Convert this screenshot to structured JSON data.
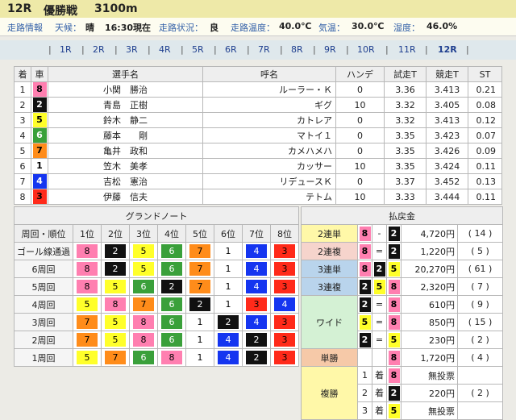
{
  "header": {
    "race": "12R",
    "name": "優勝戦",
    "distance": "3100m"
  },
  "conditions": {
    "road_info_label": "走路情報",
    "weather_label": "天候：",
    "weather": "晴",
    "time": "16:30現在",
    "track_label": "走路状況：",
    "track": "良",
    "road_temp_label": "走路温度：",
    "road_temp": "40.0℃",
    "air_temp_label": "気温：",
    "air_temp": "30.0℃",
    "humidity_label": "湿度：",
    "humidity": "46.0%"
  },
  "tabs": [
    {
      "label": "1R",
      "current": false
    },
    {
      "label": "2R",
      "current": false
    },
    {
      "label": "3R",
      "current": false
    },
    {
      "label": "4R",
      "current": false
    },
    {
      "label": "5R",
      "current": false
    },
    {
      "label": "6R",
      "current": false
    },
    {
      "label": "7R",
      "current": false
    },
    {
      "label": "8R",
      "current": false
    },
    {
      "label": "9R",
      "current": false
    },
    {
      "label": "10R",
      "current": false
    },
    {
      "label": "11R",
      "current": false
    },
    {
      "label": "12R",
      "current": true
    }
  ],
  "colors": {
    "1": "#ffffff",
    "2": "#111111",
    "3": "#ff2a1a",
    "4": "#1535f0",
    "5": "#ffff2a",
    "6": "#3aa03a",
    "7": "#ff8c1a",
    "8": "#ff7fb0"
  },
  "text_colors": {
    "1": "#000",
    "2": "#fff",
    "3": "#000",
    "4": "#fff",
    "5": "#000",
    "6": "#fff",
    "7": "#000",
    "8": "#000"
  },
  "entries": {
    "headers": [
      "着",
      "車",
      "選手名",
      "呼名",
      "ハンデ",
      "試走T",
      "競走T",
      "ST"
    ],
    "rows": [
      {
        "pos": "1",
        "car": "8",
        "rider": "小関　勝治",
        "bike": "ルーラー・Ｋ",
        "hande": "0",
        "trial": "3.36",
        "race": "3.413",
        "st": "0.21"
      },
      {
        "pos": "2",
        "car": "2",
        "rider": "青島　正樹",
        "bike": "ギグ",
        "hande": "10",
        "trial": "3.32",
        "race": "3.405",
        "st": "0.08"
      },
      {
        "pos": "3",
        "car": "5",
        "rider": "鈴木　静二",
        "bike": "カトレア",
        "hande": "0",
        "trial": "3.32",
        "race": "3.413",
        "st": "0.12"
      },
      {
        "pos": "4",
        "car": "6",
        "rider": "藤本　　剛",
        "bike": "マトイ１",
        "hande": "0",
        "trial": "3.35",
        "race": "3.423",
        "st": "0.07"
      },
      {
        "pos": "5",
        "car": "7",
        "rider": "亀井　政和",
        "bike": "カメハメハ",
        "hande": "0",
        "trial": "3.35",
        "race": "3.426",
        "st": "0.09"
      },
      {
        "pos": "6",
        "car": "1",
        "rider": "笠木　美孝",
        "bike": "カッサー",
        "hande": "10",
        "trial": "3.35",
        "race": "3.424",
        "st": "0.11"
      },
      {
        "pos": "7",
        "car": "4",
        "rider": "吉松　憲治",
        "bike": "リデュースＫ",
        "hande": "0",
        "trial": "3.37",
        "race": "3.452",
        "st": "0.13"
      },
      {
        "pos": "8",
        "car": "3",
        "rider": "伊藤　信夫",
        "bike": "テトム",
        "hande": "10",
        "trial": "3.33",
        "race": "3.444",
        "st": "0.11"
      }
    ]
  },
  "grand_note": {
    "title": "グランドノート",
    "corner_label": "周回・順位",
    "headers": [
      "1位",
      "2位",
      "3位",
      "4位",
      "5位",
      "6位",
      "7位",
      "8位"
    ],
    "rows": [
      {
        "label": "ゴール線通過",
        "cells": [
          "8",
          "2",
          "5",
          "6",
          "7",
          "1",
          "4",
          "3"
        ]
      },
      {
        "label": "6周回",
        "cells": [
          "8",
          "2",
          "5",
          "6",
          "7",
          "1",
          "4",
          "3"
        ]
      },
      {
        "label": "5周回",
        "cells": [
          "8",
          "5",
          "6",
          "2",
          "7",
          "1",
          "4",
          "3"
        ]
      },
      {
        "label": "4周回",
        "cells": [
          "5",
          "8",
          "7",
          "6",
          "2",
          "1",
          "3",
          "4"
        ]
      },
      {
        "label": "3周回",
        "cells": [
          "7",
          "5",
          "8",
          "6",
          "1",
          "2",
          "4",
          "3"
        ]
      },
      {
        "label": "2周回",
        "cells": [
          "7",
          "5",
          "8",
          "6",
          "1",
          "4",
          "2",
          "3"
        ]
      },
      {
        "label": "1周回",
        "cells": [
          "5",
          "7",
          "6",
          "8",
          "1",
          "4",
          "2",
          "3"
        ]
      }
    ]
  },
  "payout": {
    "title": "払戻金",
    "rows": [
      {
        "bet": "2連単",
        "bg": "#fff8a8",
        "a": "8",
        "sym": "-",
        "b": "2",
        "amount": "4,720円",
        "pop": "( 14 )"
      },
      {
        "bet": "2連複",
        "bg": "#f6d4cc",
        "a": "8",
        "sym": "=",
        "b": "2",
        "amount": "1,220円",
        "pop": "( 5 )"
      },
      {
        "bet": "3連単",
        "bg": "#b9d4ec",
        "a": "8",
        "sym": "2",
        "b": "5",
        "amount": "20,270円",
        "pop": "( 61 )"
      },
      {
        "bet": "3連複",
        "bg": "#b9d4ec",
        "a": "2",
        "sym": "5",
        "b": "8",
        "amount": "2,320円",
        "pop": "( 7 )"
      },
      {
        "bet": "ワイド",
        "bg": "#d4f1d4",
        "a": "2",
        "sym": "=",
        "b": "8",
        "amount": "610円",
        "pop": "( 9 )"
      },
      {
        "bet": "",
        "bg": "#d4f1d4",
        "a": "5",
        "sym": "=",
        "b": "8",
        "amount": "850円",
        "pop": "( 15 )"
      },
      {
        "bet": "",
        "bg": "#d4f1d4",
        "a": "2",
        "sym": "=",
        "b": "5",
        "amount": "230円",
        "pop": "( 2 )"
      },
      {
        "bet": "単勝",
        "bg": "#f6c9a8",
        "a": "",
        "sym": "",
        "b": "8",
        "amount": "1,720円",
        "pop": "( 4 )"
      },
      {
        "bet": "複勝",
        "bg": "#fff8a8",
        "a": "1",
        "sym": "着",
        "b": "8",
        "amount": "無投票",
        "pop": ""
      },
      {
        "bet": "",
        "bg": "#fff8a8",
        "a": "2",
        "sym": "着",
        "b": "2",
        "amount": "220円",
        "pop": "( 2 )"
      },
      {
        "bet": "",
        "bg": "#fff8a8",
        "a": "3",
        "sym": "着",
        "b": "5",
        "amount": "無投票",
        "pop": ""
      }
    ]
  }
}
